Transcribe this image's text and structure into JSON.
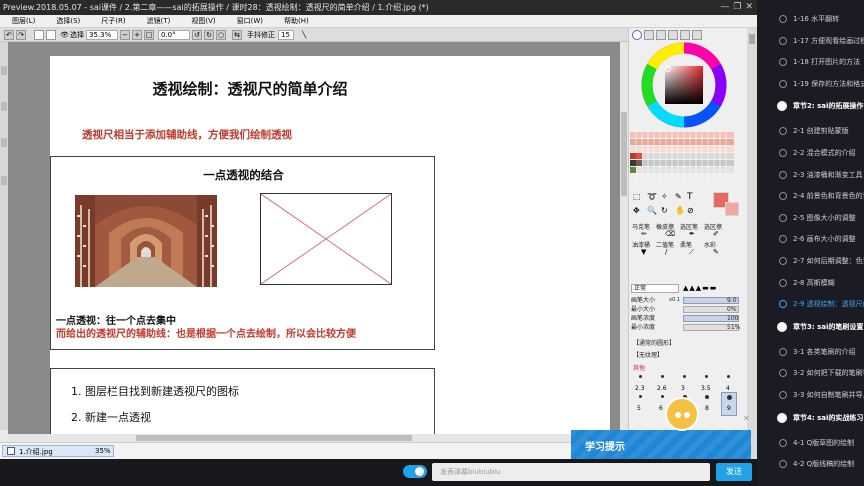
{
  "window": {
    "title": "Preview.2018.05.07 - sai课件 / 2.第二章——sai的拓展操作 / 课时28：透视绘制：透视尺的简单介绍 / 1.介绍.jpg (*)",
    "controls": [
      "—",
      "❐",
      "✕"
    ]
  },
  "menu": [
    "图层(L)",
    "选择(S)",
    "尺子(R)",
    "滤镜(T)",
    "视图(V)",
    "窗口(W)",
    "帮助(H)"
  ],
  "toolbar": {
    "select_label": "选择",
    "zoom": "35.3%",
    "angle": "0.0°",
    "stabilizer_label": "手抖修正",
    "stabilizer_value": "15",
    "icons": [
      "undo-icon",
      "redo-icon",
      "zoom-out-icon",
      "zoom-in-icon",
      "fit-icon",
      "rotate-left-icon",
      "rotate-right-icon",
      "reset-icon",
      "flip-icon",
      "line-icon"
    ]
  },
  "document": {
    "title": "透视绘制：透视尺的简单介绍",
    "subtitle": "透视尺相当于添加辅助线，方便我们绘制透视",
    "box1_title": "一点透视的结合",
    "box1_note_black": "一点透视：往一个点去集中",
    "box1_note_red": "而给出的透视尺的辅助线：也是根据一个点去绘制，所以会比较方便",
    "steps": [
      "1. 图层栏目找到新建透视尺的图标",
      "2. 新建一点透视"
    ]
  },
  "status": {
    "filename": "1.介绍.jpg",
    "zoom": "35%"
  },
  "panel": {
    "tools": [
      "马克笔",
      "橡皮擦",
      "选区笔",
      "选区擦",
      "油漆桶",
      "二值笔",
      "柔笔",
      "水彩"
    ],
    "mode": "正常",
    "size_label": "画笔大小",
    "size_mult": "x0.1",
    "size_value": "9.0",
    "min_size_label": "最小大小",
    "min_size_value": "0%",
    "density_label": "画笔浓度",
    "density_value": "100",
    "min_density_label": "最小浓度",
    "min_density_value": "51%",
    "shape_label": "【通常的圆形】",
    "texture_label": "【无纹理】",
    "other_label": "其他",
    "brush_sizes": [
      "2.3",
      "2.6",
      "3",
      "3.5",
      "4",
      "5",
      "6",
      "7",
      "8",
      "9"
    ],
    "colors": {
      "primary": "#e8675f",
      "secondary": "#f0a7a0"
    }
  },
  "courses": [
    {
      "type": "lesson",
      "label": "1-16 水平翻转"
    },
    {
      "type": "lesson",
      "label": "1-17 方便观看绘画过程"
    },
    {
      "type": "lesson",
      "label": "1-18 打开图片的方法"
    },
    {
      "type": "lesson",
      "label": "1-19 保存的方法和格式"
    },
    {
      "type": "chapter",
      "label": "章节2: sai的拓展操作"
    },
    {
      "type": "lesson",
      "label": "2-1 创建剪贴蒙版"
    },
    {
      "type": "lesson",
      "label": "2-2 混合模式的介绍"
    },
    {
      "type": "lesson",
      "label": "2-3 油漆桶和渐变工具"
    },
    {
      "type": "lesson",
      "label": "2-4 前景色和背景色的调整"
    },
    {
      "type": "lesson",
      "label": "2-5 图像大小的调整"
    },
    {
      "type": "lesson",
      "label": "2-6 画布大小的调整"
    },
    {
      "type": "lesson",
      "label": "2-7 如何后期调整：色调"
    },
    {
      "type": "lesson",
      "label": "2-8 高斯模糊"
    },
    {
      "type": "lesson",
      "active": true,
      "label": "2-9 透视绘制：透视尺的简单介绍"
    },
    {
      "type": "chapter",
      "label": "章节3: sai的笔刷设置"
    },
    {
      "type": "lesson",
      "label": "3-1 各类笔刷的介绍"
    },
    {
      "type": "lesson",
      "label": "3-2 如何把下载的笔刷导入"
    },
    {
      "type": "lesson",
      "label": "3-3 如何自制笔刷并导入"
    },
    {
      "type": "chapter",
      "label": "章节4: sai的实战练习"
    },
    {
      "type": "lesson",
      "label": "4-1 Q版草图的绘制"
    },
    {
      "type": "lesson",
      "label": "4-2 Q版线稿的绘制"
    }
  ],
  "overlay": {
    "tip": "学习提示"
  },
  "danmaku": {
    "placeholder": "发表弹幕biubiubiu",
    "send": "发送"
  }
}
